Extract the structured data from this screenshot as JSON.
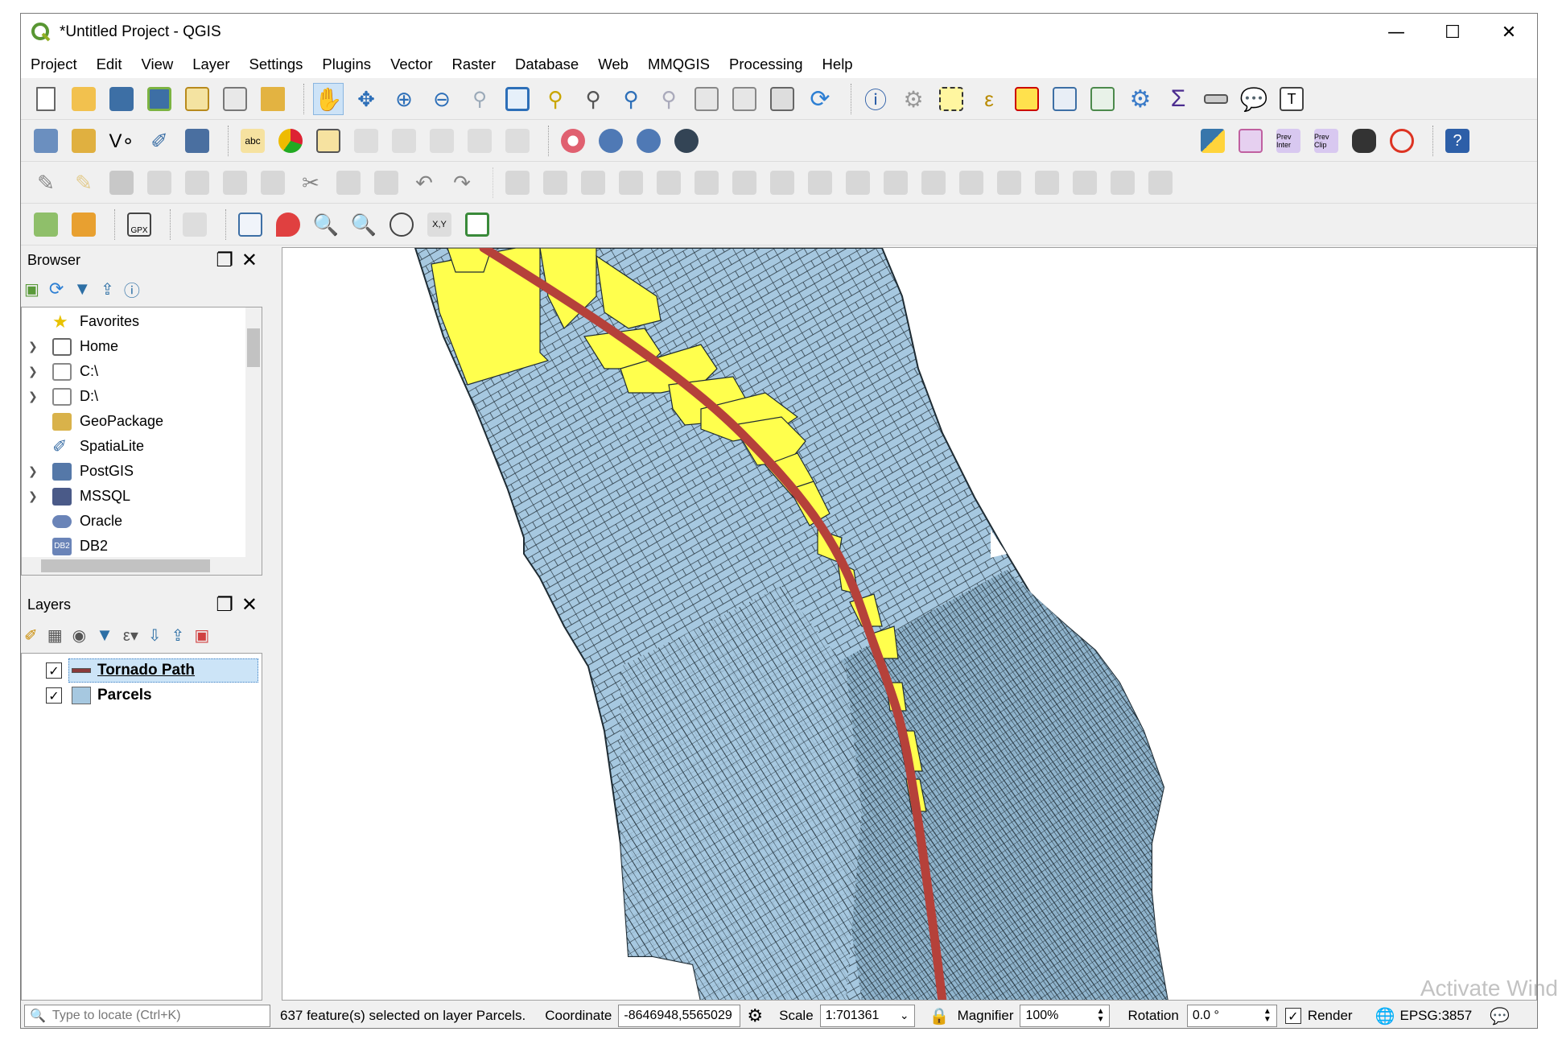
{
  "window": {
    "title": "*Untitled Project - QGIS"
  },
  "menu": [
    "Project",
    "Edit",
    "View",
    "Layer",
    "Settings",
    "Plugins",
    "Vector",
    "Raster",
    "Database",
    "Web",
    "MMQGIS",
    "Processing",
    "Help"
  ],
  "browser": {
    "title": "Browser",
    "items": [
      {
        "label": "Favorites",
        "icon": "star-icon",
        "expandable": false
      },
      {
        "label": "Home",
        "icon": "home-folder-icon",
        "expandable": true
      },
      {
        "label": "C:\\",
        "icon": "folder-icon",
        "expandable": true
      },
      {
        "label": "D:\\",
        "icon": "folder-icon",
        "expandable": true
      },
      {
        "label": "GeoPackage",
        "icon": "geopackage-icon",
        "expandable": false
      },
      {
        "label": "SpatiaLite",
        "icon": "spatialite-icon",
        "expandable": false
      },
      {
        "label": "PostGIS",
        "icon": "postgis-elephant-icon",
        "expandable": true
      },
      {
        "label": "MSSQL",
        "icon": "mssql-icon",
        "expandable": true
      },
      {
        "label": "Oracle",
        "icon": "oracle-icon",
        "expandable": false
      },
      {
        "label": "DB2",
        "icon": "db2-icon",
        "expandable": false
      }
    ]
  },
  "layers": {
    "title": "Layers",
    "items": [
      {
        "label": "Tornado Path",
        "checked": true,
        "selected": true,
        "swatch": "#8b3a3a"
      },
      {
        "label": "Parcels",
        "checked": true,
        "selected": false,
        "swatch": "#a6c8e0"
      }
    ]
  },
  "statusbar": {
    "locate_placeholder": "Type to locate (Ctrl+K)",
    "message": "637 feature(s) selected on layer Parcels.",
    "coordinate_label": "Coordinate",
    "coordinate_value": "-8646948,5565029",
    "scale_label": "Scale",
    "scale_value": "1:701361",
    "magnifier_label": "Magnifier",
    "magnifier_value": "100%",
    "rotation_label": "Rotation",
    "rotation_value": "0.0 °",
    "render_label": "Render",
    "crs": "EPSG:3857"
  },
  "watermark": "Activate Wind",
  "colors": {
    "parcel_fill": "#a6c8e0",
    "selected_fill": "#ffff4d",
    "tornado_line": "#b5413a",
    "parcel_outline": "#1e2b33"
  }
}
